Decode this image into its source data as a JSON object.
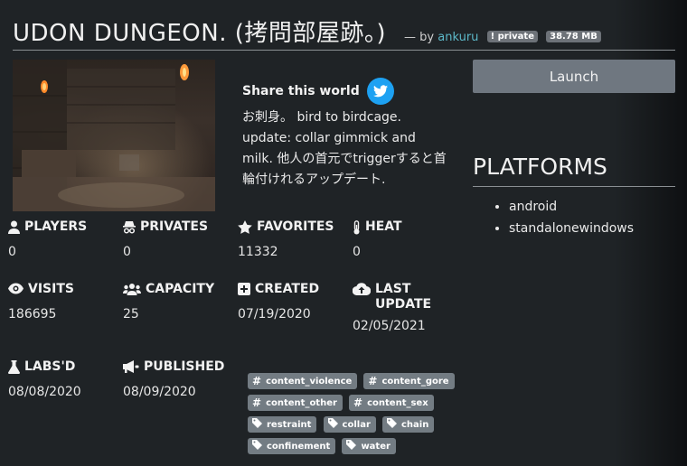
{
  "header": {
    "title": "UDON DUNGEON. (拷問部屋跡。)",
    "by_prefix": "— by",
    "author": "ankuru",
    "badge_private": "private",
    "badge_size": "38.78 MB"
  },
  "share": {
    "label": "Share this world",
    "icon": "twitter-icon"
  },
  "description": "お刺身。 bird to birdcage. update: collar gimmick and milk. 他人の首元でtriggerすると首輪付けれるアップデート.",
  "launch_label": "Launch",
  "platforms": {
    "heading": "PLATFORMS",
    "items": [
      "android",
      "standalonewindows"
    ]
  },
  "stats": {
    "players": {
      "label": "PLAYERS",
      "value": "0",
      "icon": "user-icon"
    },
    "privates": {
      "label": "PRIVATES",
      "value": "0",
      "icon": "incognito-icon"
    },
    "favorites": {
      "label": "FAVORITES",
      "value": "11332",
      "icon": "star-icon"
    },
    "heat": {
      "label": "HEAT",
      "value": "0",
      "icon": "thermometer-icon"
    },
    "visits": {
      "label": "VISITS",
      "value": "186695",
      "icon": "eye-icon"
    },
    "capacity": {
      "label": "CAPACITY",
      "value": "25",
      "icon": "users-icon"
    },
    "created": {
      "label": "CREATED",
      "value": "07/19/2020",
      "icon": "plus-square-icon"
    },
    "updated": {
      "label": "LAST UPDATE",
      "value": "02/05/2021",
      "icon": "cloud-upload-icon"
    },
    "labs": {
      "label": "LABS'D",
      "value": "08/08/2020",
      "icon": "flask-icon"
    },
    "published": {
      "label": "PUBLISHED",
      "value": "08/09/2020",
      "icon": "megaphone-icon"
    }
  },
  "tags": [
    {
      "label": "content_violence",
      "kind": "hash"
    },
    {
      "label": "content_gore",
      "kind": "hash"
    },
    {
      "label": "content_other",
      "kind": "hash"
    },
    {
      "label": "content_sex",
      "kind": "hash"
    },
    {
      "label": "restraint",
      "kind": "tag"
    },
    {
      "label": "collar",
      "kind": "tag"
    },
    {
      "label": "chain",
      "kind": "tag"
    },
    {
      "label": "confinement",
      "kind": "tag"
    },
    {
      "label": "water",
      "kind": "tag"
    }
  ],
  "colors": {
    "background": "#1f2326",
    "author_link": "#5cb8c8",
    "twitter": "#1da1f2",
    "launch": "#6f7780",
    "tag": "#737c83"
  }
}
